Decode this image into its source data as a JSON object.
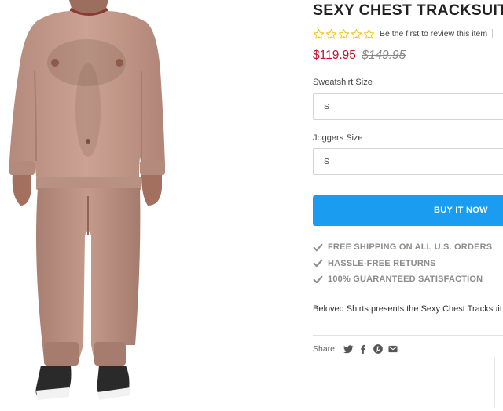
{
  "product": {
    "title": "SEXY CHEST TRACKSUIT",
    "review_link": "Be the first to review this item",
    "star_count": 5,
    "price_sale": "$119.95",
    "price_original": "$149.95",
    "sweatshirt_size_label": "Sweatshirt Size",
    "sweatshirt_size_value": "S",
    "joggers_size_label": "Joggers Size",
    "joggers_size_value": "S",
    "buy_label": "BUY IT NOW",
    "benefits": [
      "FREE SHIPPING ON ALL U.S. ORDERS",
      "HASSLE-FREE RETURNS",
      "100% GUARANTEED SATISFACTION"
    ],
    "description": "Beloved Shirts presents the Sexy Chest Tracksuit",
    "share_label": "Share:"
  },
  "icons": [
    "star-outline-icon",
    "check-icon",
    "twitter-icon",
    "facebook-icon",
    "pinterest-icon",
    "email-icon"
  ],
  "colors": {
    "accent": "#1a9cf0",
    "sale_price": "#c8102e",
    "stars": "#f2c81b",
    "benefit_text": "#8c8c8c"
  }
}
